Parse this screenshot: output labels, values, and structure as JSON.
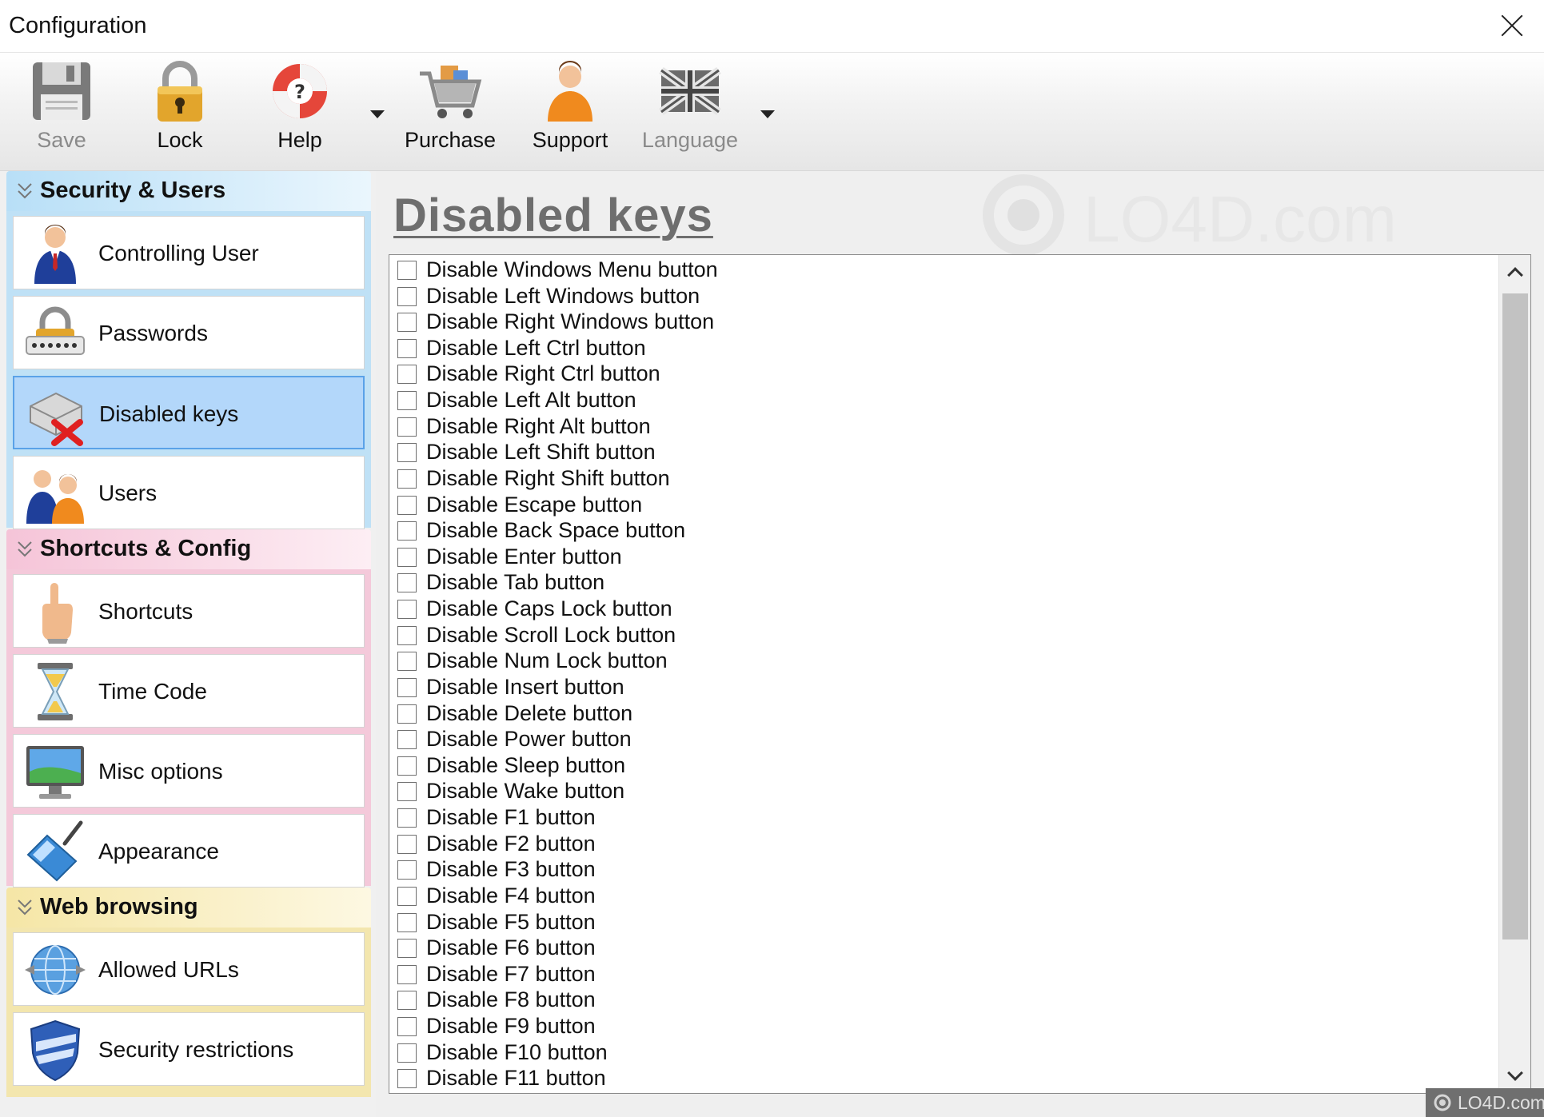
{
  "window": {
    "title": "Configuration"
  },
  "toolbar": {
    "save": "Save",
    "lock": "Lock",
    "help": "Help",
    "purchase": "Purchase",
    "support": "Support",
    "language": "Language"
  },
  "sidebar": {
    "groups": [
      {
        "title": "Security & Users",
        "items": [
          "Controlling User",
          "Passwords",
          "Disabled keys",
          "Users"
        ]
      },
      {
        "title": "Shortcuts & Config",
        "items": [
          "Shortcuts",
          "Time Code",
          "Misc options",
          "Appearance"
        ]
      },
      {
        "title": "Web browsing",
        "items": [
          "Allowed URLs",
          "Security restrictions"
        ]
      }
    ],
    "selected": "Disabled keys"
  },
  "main": {
    "heading": "Disabled keys",
    "watermark": "LO4D.com",
    "options": [
      "Disable Windows Menu button",
      "Disable Left Windows button",
      "Disable Right Windows button",
      "Disable Left Ctrl button",
      "Disable Right Ctrl button",
      "Disable Left Alt button",
      "Disable Right Alt button",
      "Disable Left Shift button",
      "Disable Right Shift button",
      "Disable Escape button",
      "Disable Back Space button",
      "Disable Enter button",
      "Disable Tab button",
      "Disable Caps Lock button",
      "Disable Scroll Lock button",
      "Disable Num Lock button",
      "Disable Insert button",
      "Disable Delete button",
      "Disable Power button",
      "Disable Sleep button",
      "Disable Wake button",
      "Disable F1 button",
      "Disable F2 button",
      "Disable F3 button",
      "Disable F4 button",
      "Disable F5 button",
      "Disable F6 button",
      "Disable F7 button",
      "Disable F8 button",
      "Disable F9 button",
      "Disable F10 button",
      "Disable F11 button"
    ]
  },
  "badge": "LO4D.com",
  "colors": {
    "selected_bg": "#b3d7fa",
    "selected_border": "#5aa2e8",
    "group1": "#bfe1f6",
    "group2": "#f4c9da",
    "group3": "#f3e6ae",
    "heading": "#6e6e6e"
  }
}
